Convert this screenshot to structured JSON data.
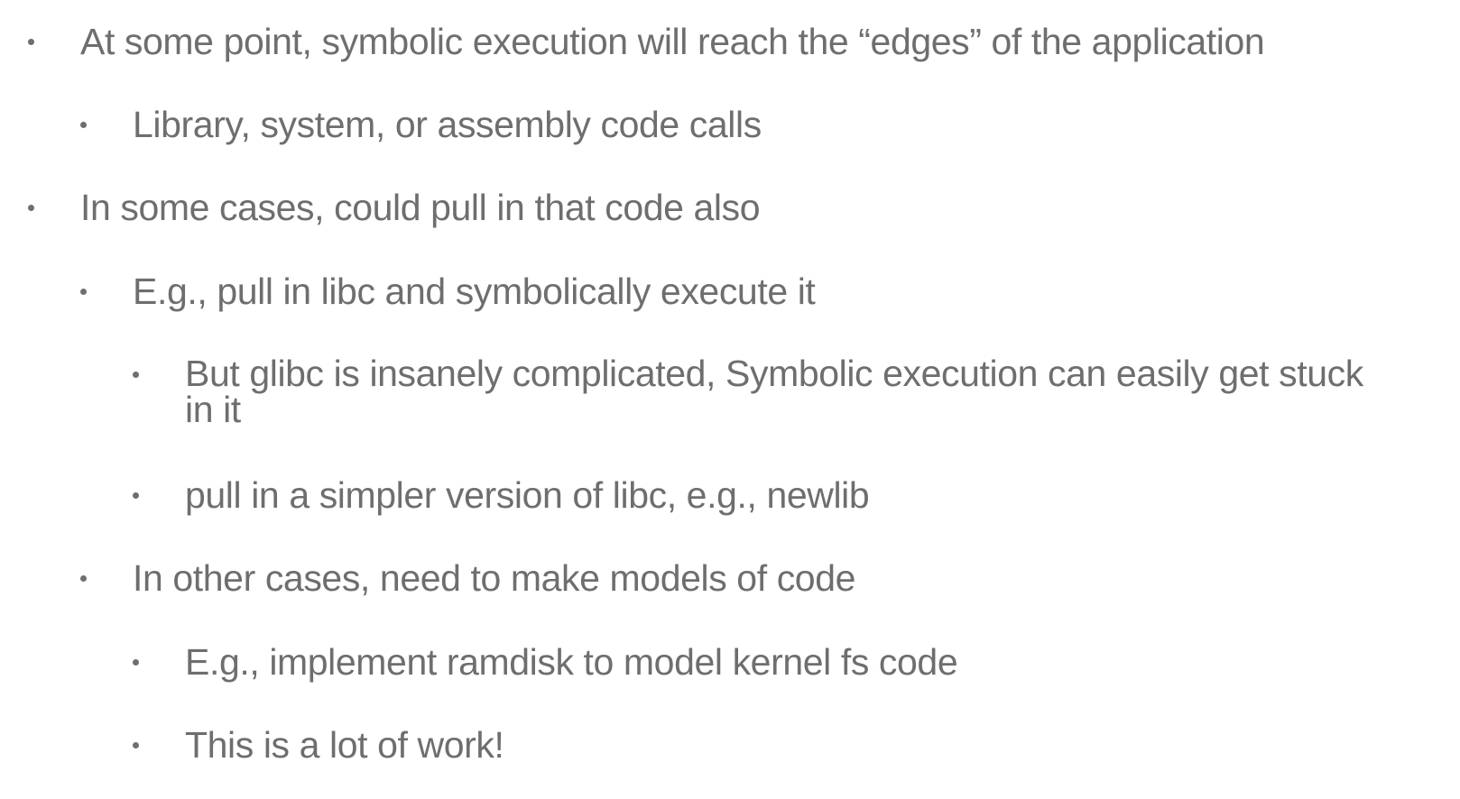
{
  "slide": {
    "bullets": [
      {
        "level": 1,
        "text": "At some point, symbolic execution will reach the “edges” of the application"
      },
      {
        "level": 2,
        "text": "Library, system, or assembly code calls"
      },
      {
        "level": 1,
        "text": "In some cases, could pull in that code also"
      },
      {
        "level": 2,
        "text": "E.g., pull in libc and symbolically execute it"
      },
      {
        "level": 3,
        "text": "But glibc is insanely complicated, Symbolic execution can easily get stuck in it"
      },
      {
        "level": 3,
        "text": "pull in a simpler version of libc, e.g., newlib"
      },
      {
        "level": 2,
        "text": "In other cases, need to make models of code"
      },
      {
        "level": 3,
        "text": "E.g., implement ramdisk to model kernel fs code"
      },
      {
        "level": 3,
        "text": "This is a lot of work!"
      }
    ]
  }
}
